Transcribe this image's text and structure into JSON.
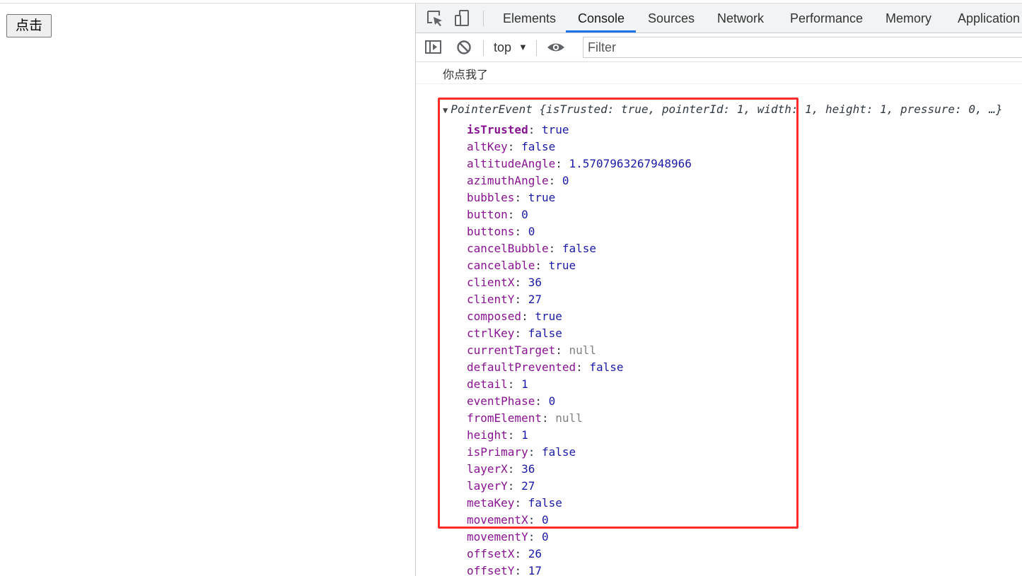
{
  "page": {
    "button_label": "点击"
  },
  "devtools": {
    "tabs": [
      {
        "label": "Elements"
      },
      {
        "label": "Console"
      },
      {
        "label": "Sources"
      },
      {
        "label": "Network"
      },
      {
        "label": "Performance"
      },
      {
        "label": "Memory"
      },
      {
        "label": "Application"
      }
    ],
    "active_tab": "Console",
    "toolbar": {
      "context": "top",
      "context_arrow": "▼",
      "filter_placeholder": "Filter"
    },
    "accent_color": "#1a73e8"
  },
  "console": {
    "log_message": "你点我了",
    "object_header": {
      "triangle": "▼",
      "text": "PointerEvent {isTrusted: true, pointerId: 1, width: 1, height: 1, pressure: 0, …}"
    },
    "properties": [
      {
        "name": "isTrusted",
        "value": "true",
        "type": "bool",
        "bold": true
      },
      {
        "name": "altKey",
        "value": "false",
        "type": "bool"
      },
      {
        "name": "altitudeAngle",
        "value": "1.5707963267948966",
        "type": "num"
      },
      {
        "name": "azimuthAngle",
        "value": "0",
        "type": "num"
      },
      {
        "name": "bubbles",
        "value": "true",
        "type": "bool"
      },
      {
        "name": "button",
        "value": "0",
        "type": "num"
      },
      {
        "name": "buttons",
        "value": "0",
        "type": "num"
      },
      {
        "name": "cancelBubble",
        "value": "false",
        "type": "bool"
      },
      {
        "name": "cancelable",
        "value": "true",
        "type": "bool"
      },
      {
        "name": "clientX",
        "value": "36",
        "type": "num"
      },
      {
        "name": "clientY",
        "value": "27",
        "type": "num"
      },
      {
        "name": "composed",
        "value": "true",
        "type": "bool"
      },
      {
        "name": "ctrlKey",
        "value": "false",
        "type": "bool"
      },
      {
        "name": "currentTarget",
        "value": "null",
        "type": "null"
      },
      {
        "name": "defaultPrevented",
        "value": "false",
        "type": "bool"
      },
      {
        "name": "detail",
        "value": "1",
        "type": "num"
      },
      {
        "name": "eventPhase",
        "value": "0",
        "type": "num"
      },
      {
        "name": "fromElement",
        "value": "null",
        "type": "null"
      },
      {
        "name": "height",
        "value": "1",
        "type": "num"
      },
      {
        "name": "isPrimary",
        "value": "false",
        "type": "bool"
      },
      {
        "name": "layerX",
        "value": "36",
        "type": "num"
      },
      {
        "name": "layerY",
        "value": "27",
        "type": "num"
      },
      {
        "name": "metaKey",
        "value": "false",
        "type": "bool"
      },
      {
        "name": "movementX",
        "value": "0",
        "type": "num"
      },
      {
        "name": "movementY",
        "value": "0",
        "type": "num"
      },
      {
        "name": "offsetX",
        "value": "26",
        "type": "num"
      },
      {
        "name": "offsetY",
        "value": "17",
        "type": "num"
      }
    ]
  },
  "annotation": {
    "highlight_color": "#ff2a2a"
  }
}
